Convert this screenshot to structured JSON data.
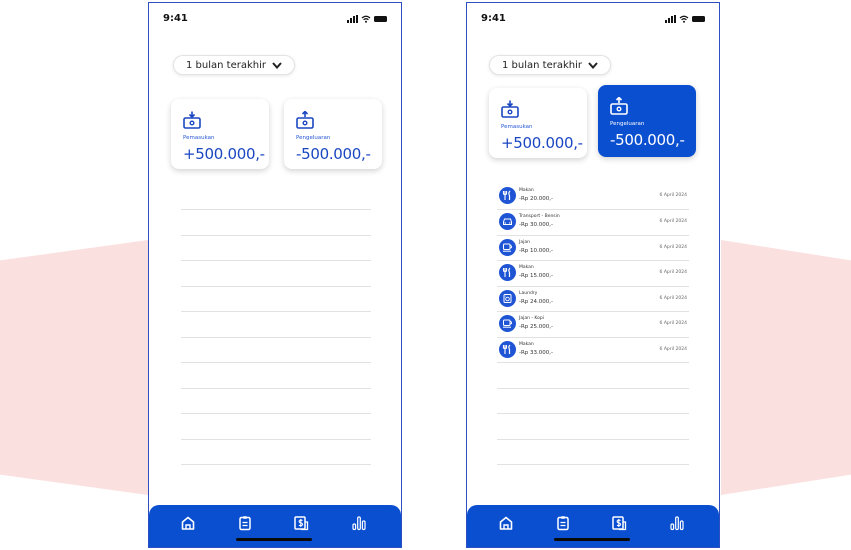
{
  "colors": {
    "primary": "#0b4fd1",
    "accent_bg": "#fbe0e0",
    "frame": "#2e4fc2"
  },
  "screens": [
    {
      "status_time": "9:41",
      "period": "1 bulan terakhir",
      "income": {
        "label": "Pemasukan",
        "amount": "+500.000,-",
        "icon": "money-in-icon"
      },
      "expense": {
        "label": "Pengeluaran",
        "amount": "-500.000,-",
        "icon": "money-out-icon"
      },
      "nav": [
        "home-icon",
        "list-icon",
        "budget-icon",
        "stats-icon"
      ]
    },
    {
      "status_time": "9:41",
      "period": "1 bulan terakhir",
      "income": {
        "label": "Pemasukan",
        "amount": "+500.000,-",
        "icon": "money-in-icon"
      },
      "expense": {
        "label": "Pengeluaran",
        "amount": "-500.000,-",
        "icon": "money-out-icon",
        "selected": true
      },
      "transactions": [
        {
          "title": "Makan",
          "amount": "-Rp 20.000,-",
          "date": "6 April 2024",
          "icon": "food-icon"
        },
        {
          "title": "Transport - Bensin",
          "amount": "-Rp 30.000,-",
          "date": "6 April 2024",
          "icon": "car-icon"
        },
        {
          "title": "Jajan",
          "amount": "-Rp 10.000,-",
          "date": "6 April 2024",
          "icon": "coffee-icon"
        },
        {
          "title": "Makan",
          "amount": "-Rp 15.000,-",
          "date": "6 April 2024",
          "icon": "food-icon"
        },
        {
          "title": "Laundry",
          "amount": "-Rp 24.000,-",
          "date": "6 April 2024",
          "icon": "laundry-icon"
        },
        {
          "title": "Jajan - Kopi",
          "amount": "-Rp 25.000,-",
          "date": "6 April 2024",
          "icon": "coffee-icon"
        },
        {
          "title": "Makan",
          "amount": "-Rp 33.000,-",
          "date": "6 April 2024",
          "icon": "food-icon"
        }
      ],
      "nav": [
        "home-icon",
        "list-icon",
        "budget-icon",
        "stats-icon"
      ]
    }
  ]
}
